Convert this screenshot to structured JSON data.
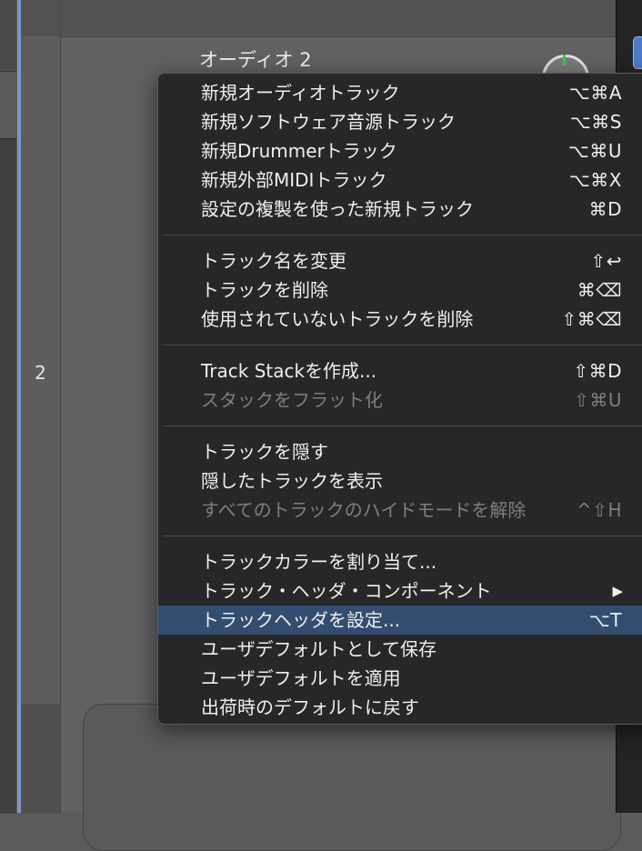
{
  "track": {
    "number": "2",
    "title": "オーディオ 2"
  },
  "left_arrows": [
    "◇",
    "◇"
  ],
  "context_menu": {
    "groups": [
      [
        {
          "label": "新規オーディオトラック",
          "shortcut": "⌥⌘A",
          "enabled": true
        },
        {
          "label": "新規ソフトウェア音源トラック",
          "shortcut": "⌥⌘S",
          "enabled": true
        },
        {
          "label": "新規Drummerトラック",
          "shortcut": "⌥⌘U",
          "enabled": true
        },
        {
          "label": "新規外部MIDIトラック",
          "shortcut": "⌥⌘X",
          "enabled": true
        },
        {
          "label": "設定の複製を使った新規トラック",
          "shortcut": "⌘D",
          "enabled": true
        }
      ],
      [
        {
          "label": "トラック名を変更",
          "shortcut": "⇧↩",
          "enabled": true
        },
        {
          "label": "トラックを削除",
          "shortcut": "⌘⌫",
          "enabled": true
        },
        {
          "label": "使用されていないトラックを削除",
          "shortcut": "⇧⌘⌫",
          "enabled": true
        }
      ],
      [
        {
          "label": "Track Stackを作成...",
          "shortcut": "⇧⌘D",
          "enabled": true
        },
        {
          "label": "スタックをフラット化",
          "shortcut": "⇧⌘U",
          "enabled": false
        }
      ],
      [
        {
          "label": "トラックを隠す",
          "shortcut": "",
          "enabled": true
        },
        {
          "label": "隠したトラックを表示",
          "shortcut": "",
          "enabled": true
        },
        {
          "label": "すべてのトラックのハイドモードを解除",
          "shortcut": "^⇧H",
          "enabled": false
        }
      ],
      [
        {
          "label": "トラックカラーを割り当て...",
          "shortcut": "",
          "enabled": true
        },
        {
          "label": "トラック・ヘッダ・コンポーネント",
          "shortcut": "",
          "enabled": true,
          "submenu": "▶"
        },
        {
          "label": "トラックヘッダを設定...",
          "shortcut": "⌥T",
          "enabled": true,
          "selected": true
        },
        {
          "label": "ユーザデフォルトとして保存",
          "shortcut": "",
          "enabled": true
        },
        {
          "label": "ユーザデフォルトを適用",
          "shortcut": "",
          "enabled": true
        },
        {
          "label": "出荷時のデフォルトに戻す",
          "shortcut": "",
          "enabled": true
        }
      ]
    ]
  },
  "colors": {
    "menu_bg": "#272729",
    "highlight": "#324d70",
    "disabled_text": "#7e7e80",
    "selection_line": "#7d97c7"
  }
}
